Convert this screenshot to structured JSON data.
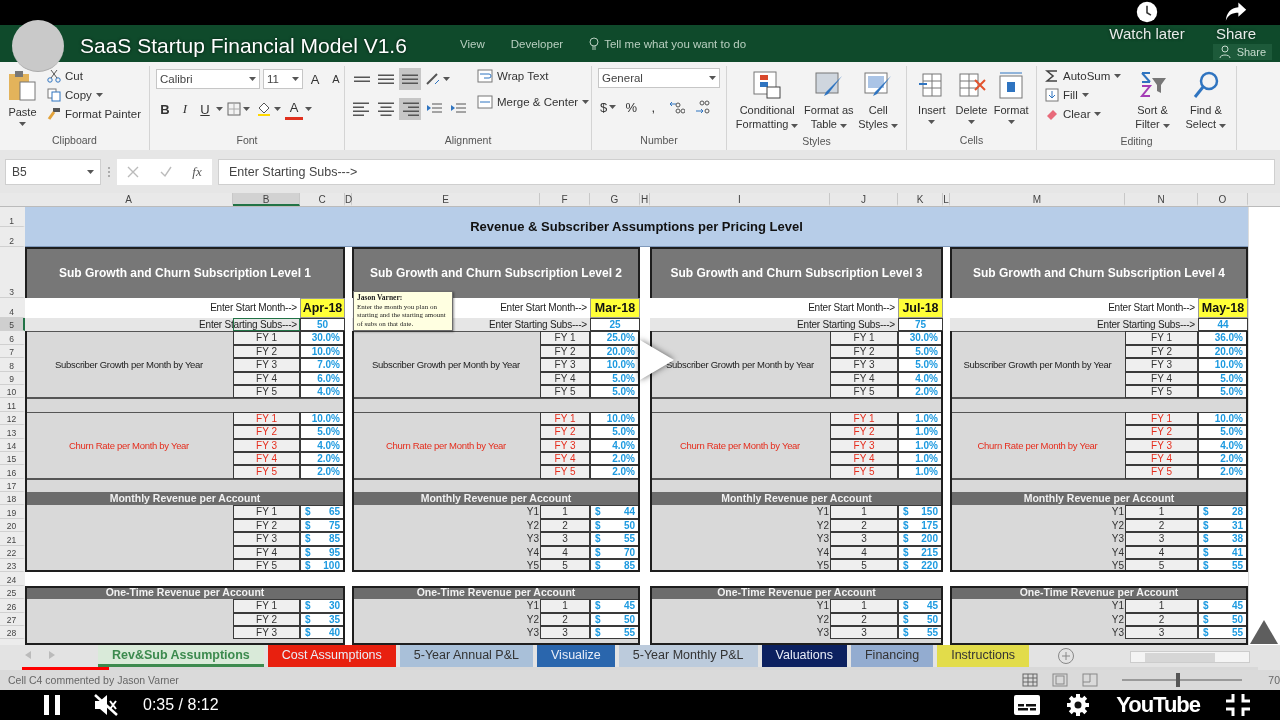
{
  "video": {
    "title": "SaaS Startup Financial Model V1.6",
    "watch_later": "Watch later",
    "share": "Share",
    "time": "0:35 / 8:12",
    "logo": "YouTube",
    "progress": {
      "level": 0.07
    }
  },
  "ribbon": {
    "tabs": [
      {
        "label": "View"
      },
      {
        "label": "Developer"
      }
    ],
    "tell_me": "Tell me what you want to do",
    "share": "Share",
    "clipboard": {
      "paste": "Paste",
      "cut": "Cut",
      "copy": "Copy",
      "format_painter": "Format Painter",
      "label": "Clipboard"
    },
    "font": {
      "name": "Calibri",
      "size": "11",
      "grow": "A",
      "shrink": "A",
      "bold": "B",
      "italic": "I",
      "underline": "U",
      "text_color": "A",
      "label": "Font"
    },
    "alignment": {
      "vertical": [
        {
          "selected": false
        },
        {
          "selected": false
        },
        {
          "selected": true
        }
      ],
      "horizontal": [
        {
          "selected": false
        },
        {
          "selected": false
        },
        {
          "selected": true
        }
      ],
      "wrap": "Wrap Text",
      "merge": "Merge & Center",
      "label": "Alignment"
    },
    "number": {
      "format": "General",
      "currency": "$",
      "percent": "%",
      "comma": ",",
      "label": "Number"
    },
    "styles": {
      "commands": [
        {
          "label": "Conditional Formatting"
        },
        {
          "label": "Format as Table"
        },
        {
          "label": "Cell Styles"
        }
      ],
      "label": "Styles"
    },
    "cells": {
      "commands": [
        {
          "label": "Insert"
        },
        {
          "label": "Delete"
        },
        {
          "label": "Format"
        }
      ],
      "label": "Cells"
    },
    "editing": {
      "autosum": "AutoSum",
      "fill": "Fill",
      "clear": "Clear",
      "sort": "Sort & Filter",
      "find": "Find & Select",
      "label": "Editing"
    }
  },
  "formula_bar": {
    "name_box": "B5",
    "fx": "fx",
    "formula": "Enter Starting Subs--->"
  },
  "sheet": {
    "columns": [
      {
        "label": "A",
        "selected": false
      },
      {
        "label": "B",
        "selected": true
      },
      {
        "label": "C",
        "selected": false
      },
      {
        "label": "D",
        "selected": false
      },
      {
        "label": "E",
        "selected": false
      },
      {
        "label": "F",
        "selected": false
      },
      {
        "label": "G",
        "selected": false
      },
      {
        "label": "H",
        "selected": false
      },
      {
        "label": "I",
        "selected": false
      },
      {
        "label": "J",
        "selected": false
      },
      {
        "label": "K",
        "selected": false
      },
      {
        "label": "L",
        "selected": false
      },
      {
        "label": "M",
        "selected": false
      },
      {
        "label": "N",
        "selected": false
      },
      {
        "label": "O",
        "selected": false
      }
    ],
    "row_numbers": [
      {
        "label": "1",
        "selected": false
      },
      {
        "label": "2",
        "selected": false
      },
      {
        "label": "3",
        "selected": false
      },
      {
        "label": "4",
        "selected": false
      },
      {
        "label": "5",
        "selected": true
      },
      {
        "label": "6",
        "selected": false
      },
      {
        "label": "7",
        "selected": false
      },
      {
        "label": "8",
        "selected": false
      },
      {
        "label": "9",
        "selected": false
      },
      {
        "label": "10",
        "selected": false
      },
      {
        "label": "11",
        "selected": false
      },
      {
        "label": "12",
        "selected": false
      },
      {
        "label": "13",
        "selected": false
      },
      {
        "label": "14",
        "selected": false
      },
      {
        "label": "15",
        "selected": false
      },
      {
        "label": "16",
        "selected": false
      },
      {
        "label": "17",
        "selected": false
      },
      {
        "label": "18",
        "selected": false
      },
      {
        "label": "19",
        "selected": false
      },
      {
        "label": "20",
        "selected": false
      },
      {
        "label": "21",
        "selected": false
      },
      {
        "label": "22",
        "selected": false
      },
      {
        "label": "23",
        "selected": false
      },
      {
        "label": "24",
        "selected": false
      },
      {
        "label": "25",
        "selected": false
      },
      {
        "label": "26",
        "selected": false
      },
      {
        "label": "27",
        "selected": false
      },
      {
        "label": "28",
        "selected": false
      }
    ],
    "title": "Revenue & Subscriber Assumptions per Pricing Level",
    "panels": [
      {
        "header": "Sub Growth and Churn Subscription Level 1",
        "start_month_label": "Enter Start Month-->",
        "start_month": "Apr-18",
        "subs_label": "Enter Starting Subs--->",
        "subs": "50",
        "growth": {
          "label": "Subscriber Growth per Month by Year",
          "rows": [
            {
              "year": "FY 1",
              "value": "30.0%"
            },
            {
              "year": "FY 2",
              "value": "10.0%"
            },
            {
              "year": "FY 3",
              "value": "7.0%"
            },
            {
              "year": "FY 4",
              "value": "6.0%"
            },
            {
              "year": "FY 5",
              "value": "4.0%"
            }
          ]
        },
        "churn": {
          "label": "Churn Rate per Month by Year",
          "rows": [
            {
              "year": "FY 1",
              "value": "10.0%"
            },
            {
              "year": "FY 2",
              "value": "5.0%"
            },
            {
              "year": "FY 3",
              "value": "4.0%"
            },
            {
              "year": "FY 4",
              "value": "2.0%"
            },
            {
              "year": "FY 5",
              "value": "2.0%"
            }
          ]
        },
        "monthly": {
          "header": "Monthly Revenue per Account",
          "rows": [
            {
              "year": "FY 1",
              "currency": "$",
              "amount": "65"
            },
            {
              "year": "FY 2",
              "currency": "$",
              "amount": "75"
            },
            {
              "year": "FY 3",
              "currency": "$",
              "amount": "85"
            },
            {
              "year": "FY 4",
              "currency": "$",
              "amount": "95"
            },
            {
              "year": "FY 5",
              "currency": "$",
              "amount": "100"
            }
          ]
        },
        "one_time": {
          "header": "One-Time Revenue per Account",
          "rows": [
            {
              "year": "FY 1",
              "currency": "$",
              "amount": "30"
            },
            {
              "year": "FY 2",
              "currency": "$",
              "amount": "35"
            },
            {
              "year": "FY 3",
              "currency": "$",
              "amount": "40"
            }
          ]
        }
      },
      {
        "header": "Sub Growth and Churn Subscription Level 2",
        "start_month_label": "Enter Start Month-->",
        "start_month": "Mar-18",
        "subs_label": "Enter Starting Subs--->",
        "subs": "25",
        "growth": {
          "label": "Subscriber Growth per Month by Year",
          "rows": [
            {
              "year": "FY 1",
              "value": "25.0%"
            },
            {
              "year": "FY 2",
              "value": "20.0%"
            },
            {
              "year": "FY 3",
              "value": "10.0%"
            },
            {
              "year": "FY 4",
              "value": "5.0%"
            },
            {
              "year": "FY 5",
              "value": "5.0%"
            }
          ]
        },
        "churn": {
          "label": "Churn Rate per Month by Year",
          "rows": [
            {
              "year": "FY 1",
              "value": "10.0%"
            },
            {
              "year": "FY 2",
              "value": "5.0%"
            },
            {
              "year": "FY 3",
              "value": "4.0%"
            },
            {
              "year": "FY 4",
              "value": "2.0%"
            },
            {
              "year": "FY 5",
              "value": "2.0%"
            }
          ]
        },
        "monthly": {
          "header": "Monthly Revenue per Account",
          "rows": [
            {
              "year_label": "Y1",
              "year": "1",
              "currency": "$",
              "amount": "44"
            },
            {
              "year_label": "Y2",
              "year": "2",
              "currency": "$",
              "amount": "50"
            },
            {
              "year_label": "Y3",
              "year": "3",
              "currency": "$",
              "amount": "55"
            },
            {
              "year_label": "Y4",
              "year": "4",
              "currency": "$",
              "amount": "70"
            },
            {
              "year_label": "Y5",
              "year": "5",
              "currency": "$",
              "amount": "85"
            }
          ]
        },
        "one_time": {
          "header": "One-Time Revenue per Account",
          "rows": [
            {
              "year_label": "Y1",
              "year": "1",
              "currency": "$",
              "amount": "45"
            },
            {
              "year_label": "Y2",
              "year": "2",
              "currency": "$",
              "amount": "50"
            },
            {
              "year_label": "Y3",
              "year": "3",
              "currency": "$",
              "amount": "55"
            }
          ]
        }
      },
      {
        "header": "Sub Growth and Churn Subscription Level 3",
        "start_month_label": "Enter Start Month-->",
        "start_month": "Jul-18",
        "subs_label": "Enter Starting Subs--->",
        "subs": "75",
        "growth": {
          "label": "Subscriber Growth per Month by Year",
          "rows": [
            {
              "year": "FY 1",
              "value": "30.0%"
            },
            {
              "year": "FY 2",
              "value": "5.0%"
            },
            {
              "year": "FY 3",
              "value": "5.0%"
            },
            {
              "year": "FY 4",
              "value": "4.0%"
            },
            {
              "year": "FY 5",
              "value": "2.0%"
            }
          ]
        },
        "churn": {
          "label": "Churn Rate per Month by Year",
          "rows": [
            {
              "year": "FY 1",
              "value": "1.0%"
            },
            {
              "year": "FY 2",
              "value": "1.0%"
            },
            {
              "year": "FY 3",
              "value": "1.0%"
            },
            {
              "year": "FY 4",
              "value": "1.0%"
            },
            {
              "year": "FY 5",
              "value": "1.0%"
            }
          ]
        },
        "monthly": {
          "header": "Monthly Revenue per Account",
          "rows": [
            {
              "year_label": "Y1",
              "year": "1",
              "currency": "$",
              "amount": "150"
            },
            {
              "year_label": "Y2",
              "year": "2",
              "currency": "$",
              "amount": "175"
            },
            {
              "year_label": "Y3",
              "year": "3",
              "currency": "$",
              "amount": "200"
            },
            {
              "year_label": "Y4",
              "year": "4",
              "currency": "$",
              "amount": "215"
            },
            {
              "year_label": "Y5",
              "year": "5",
              "currency": "$",
              "amount": "220"
            }
          ]
        },
        "one_time": {
          "header": "One-Time Revenue per Account",
          "rows": [
            {
              "year_label": "Y1",
              "year": "1",
              "currency": "$",
              "amount": "45"
            },
            {
              "year_label": "Y2",
              "year": "2",
              "currency": "$",
              "amount": "50"
            },
            {
              "year_label": "Y3",
              "year": "3",
              "currency": "$",
              "amount": "55"
            }
          ]
        }
      },
      {
        "header": "Sub Growth and Churn Subscription Level 4",
        "start_month_label": "Enter Start Month-->",
        "start_month": "May-18",
        "subs_label": "Enter Starting Subs--->",
        "subs": "44",
        "growth": {
          "label": "Subscriber Growth per Month by Year",
          "rows": [
            {
              "year": "FY 1",
              "value": "36.0%"
            },
            {
              "year": "FY 2",
              "value": "20.0%"
            },
            {
              "year": "FY 3",
              "value": "10.0%"
            },
            {
              "year": "FY 4",
              "value": "5.0%"
            },
            {
              "year": "FY 5",
              "value": "5.0%"
            }
          ]
        },
        "churn": {
          "label": "Churn Rate per Month by Year",
          "rows": [
            {
              "year": "FY 1",
              "value": "10.0%"
            },
            {
              "year": "FY 2",
              "value": "5.0%"
            },
            {
              "year": "FY 3",
              "value": "4.0%"
            },
            {
              "year": "FY 4",
              "value": "2.0%"
            },
            {
              "year": "FY 5",
              "value": "2.0%"
            }
          ]
        },
        "monthly": {
          "header": "Monthly Revenue per Account",
          "rows": [
            {
              "year_label": "Y1",
              "year": "1",
              "currency": "$",
              "amount": "28"
            },
            {
              "year_label": "Y2",
              "year": "2",
              "currency": "$",
              "amount": "31"
            },
            {
              "year_label": "Y3",
              "year": "3",
              "currency": "$",
              "amount": "38"
            },
            {
              "year_label": "Y4",
              "year": "4",
              "currency": "$",
              "amount": "41"
            },
            {
              "year_label": "Y5",
              "year": "5",
              "currency": "$",
              "amount": "55"
            }
          ]
        },
        "one_time": {
          "header": "One-Time Revenue per Account",
          "rows": [
            {
              "year_label": "Y1",
              "year": "1",
              "currency": "$",
              "amount": "45"
            },
            {
              "year_label": "Y2",
              "year": "2",
              "currency": "$",
              "amount": "50"
            },
            {
              "year_label": "Y3",
              "year": "3",
              "currency": "$",
              "amount": "55"
            }
          ]
        }
      }
    ],
    "comment": {
      "author": "Jason Varner:",
      "text": "Enter the month you plan on starting and the starting amount of subs on that date."
    }
  },
  "sheet_tabs": [
    {
      "label": "Rev&Sub Assumptions",
      "color": "#3c8a4e",
      "selected": true
    },
    {
      "label": "Cost Assumptions",
      "color": "#e8200f",
      "selected": false
    },
    {
      "label": "5-Year Annual P&L",
      "color": "#a9c0d9",
      "selected": false
    },
    {
      "label": "Visualize",
      "color": "#2a66ad",
      "selected": false
    },
    {
      "label": "5-Year Monthly P&L",
      "color": "#bccbdc",
      "selected": false
    },
    {
      "label": "Valuations",
      "color": "#0c2160",
      "selected": false
    },
    {
      "label": "Financing",
      "color": "#93acd0",
      "selected": false
    },
    {
      "label": "Instructions",
      "color": "#e2dc4a",
      "selected": false
    }
  ],
  "status_bar": {
    "text": "Cell C4 commented by Jason Varner",
    "zoom": {
      "level": 0.45,
      "reading": "70"
    }
  }
}
